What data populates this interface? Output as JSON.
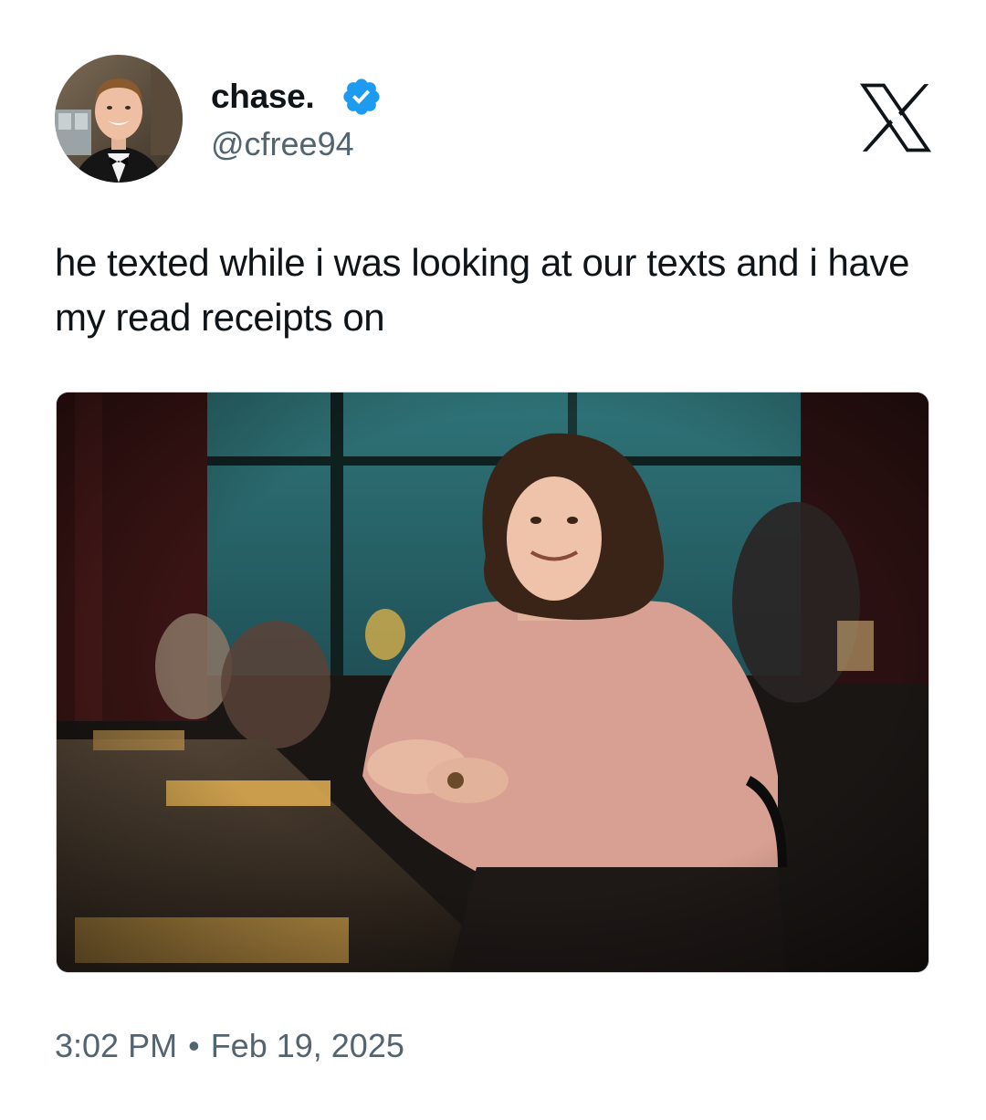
{
  "author": {
    "display_name": "chase.",
    "handle": "@cfree94",
    "verified": true,
    "avatar_icon": "profile-photo"
  },
  "platform_logo": "x-logo-icon",
  "tweet": {
    "text": "he texted while i was looking at our texts and i have my read receipts on"
  },
  "media": {
    "type": "photo",
    "icon": "attached-photo"
  },
  "meta": {
    "time": "3:02 PM",
    "separator": "•",
    "date": "Feb 19, 2025"
  },
  "colors": {
    "text_primary": "#0f1419",
    "text_secondary": "#536471",
    "verified_blue": "#1d9bf0",
    "background": "#ffffff"
  }
}
